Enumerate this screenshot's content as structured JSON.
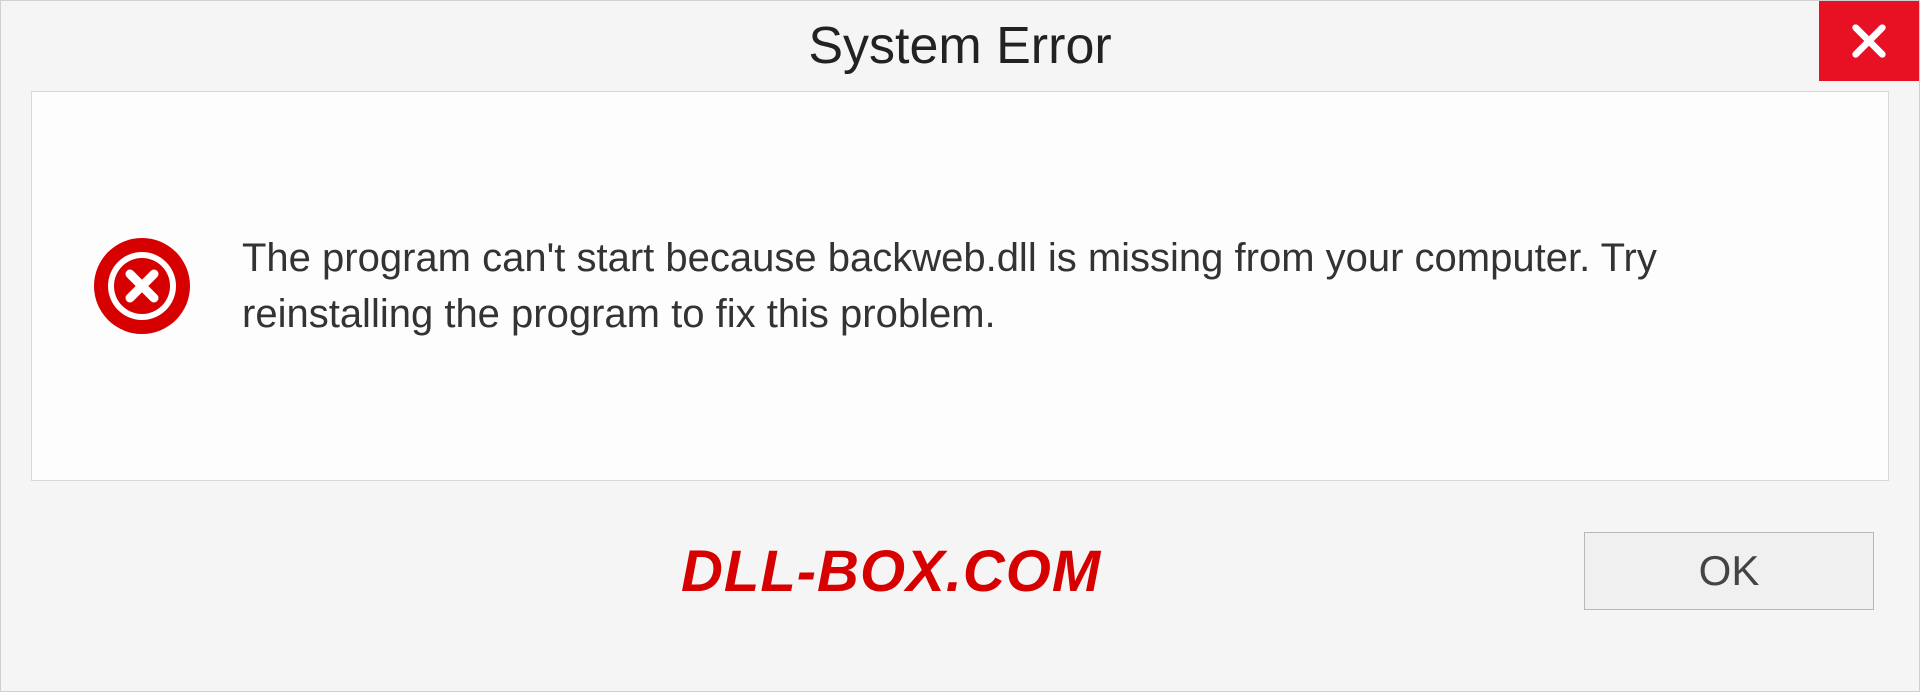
{
  "dialog": {
    "title": "System Error",
    "message": "The program can't start because backweb.dll is missing from your computer. Try reinstalling the program to fix this problem.",
    "ok_label": "OK"
  },
  "watermark": "DLL-BOX.COM"
}
